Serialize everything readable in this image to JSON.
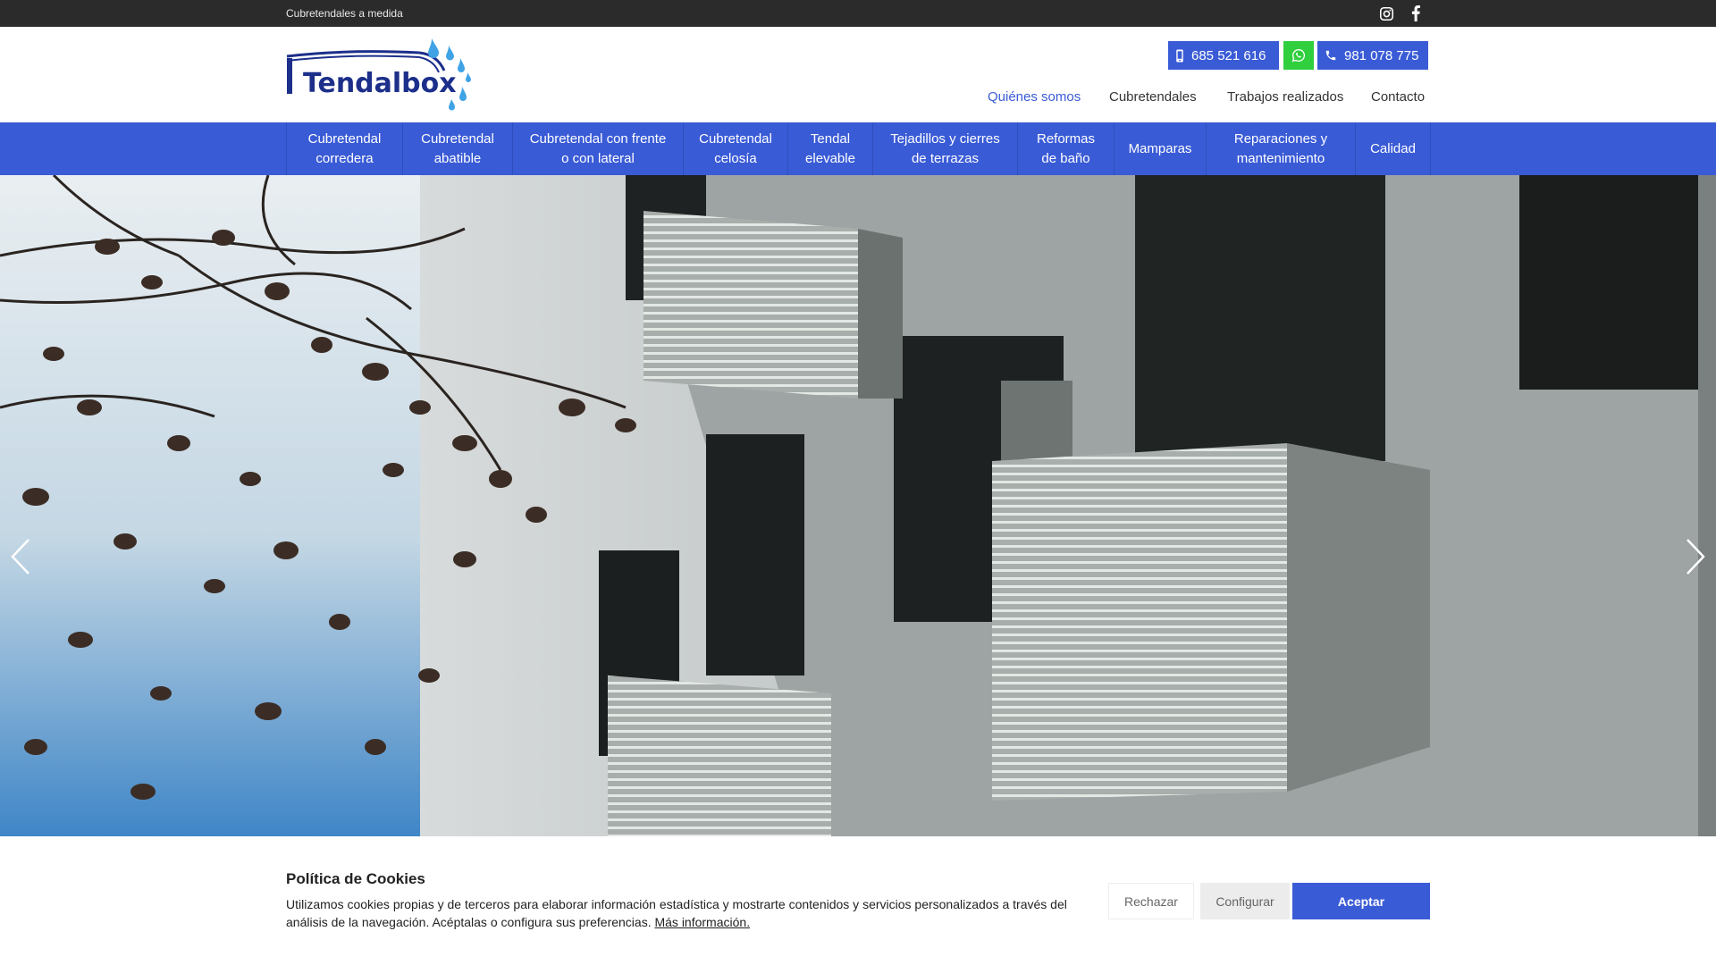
{
  "topbar": {
    "tagline": "Cubretendales a medida",
    "social": [
      "instagram-icon",
      "facebook-icon"
    ]
  },
  "header": {
    "logo_text": "Tendalbox",
    "phone_mobile": "685 521 616",
    "phone_landline": "981 078 775",
    "top_nav": [
      {
        "label": "Quiénes somos",
        "active": true
      },
      {
        "label": "Cubretendales",
        "active": false
      },
      {
        "label": "Trabajos realizados",
        "active": false
      },
      {
        "label": "Contacto",
        "active": false
      }
    ]
  },
  "main_nav": [
    {
      "line1": "Cubretendal",
      "line2": "corredera"
    },
    {
      "line1": "Cubretendal",
      "line2": "abatible"
    },
    {
      "line1": "Cubretendal con frente",
      "line2": "o con lateral"
    },
    {
      "line1": "Cubretendal",
      "line2": "celosía"
    },
    {
      "line1": "Tendal",
      "line2": "elevable"
    },
    {
      "line1": "Tejadillos y cierres",
      "line2": "de terrazas"
    },
    {
      "line1": "Reformas",
      "line2": "de baño"
    },
    {
      "line1": "Mamparas",
      "line2": ""
    },
    {
      "line1": "Reparaciones y",
      "line2": "mantenimiento"
    },
    {
      "line1": "Calidad",
      "line2": ""
    }
  ],
  "cookie": {
    "title": "Política de Cookies",
    "text": "Utilizamos cookies propias y de terceros para elaborar información estadística y mostrarte contenidos y servicios personalizados a través del análisis de la navegación. Acéptalas o configura sus preferencias.",
    "link": "Más información.",
    "reject": "Rechazar",
    "configure": "Configurar",
    "accept": "Aceptar"
  },
  "colors": {
    "accent": "#3a5bd6",
    "whatsapp": "#2fcf3e",
    "topbar": "#2b2b2b"
  }
}
